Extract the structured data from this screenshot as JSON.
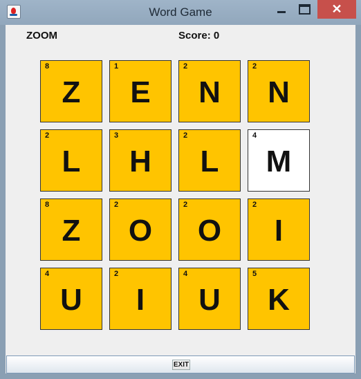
{
  "window": {
    "title": "Word Game",
    "close_symbol": "✕"
  },
  "game": {
    "current_word": "ZOOM",
    "score_label": "Score: 0"
  },
  "tiles": [
    {
      "letter": "Z",
      "points": "8",
      "selected": false
    },
    {
      "letter": "E",
      "points": "1",
      "selected": false
    },
    {
      "letter": "N",
      "points": "2",
      "selected": false
    },
    {
      "letter": "N",
      "points": "2",
      "selected": false
    },
    {
      "letter": "L",
      "points": "2",
      "selected": false
    },
    {
      "letter": "H",
      "points": "3",
      "selected": false
    },
    {
      "letter": "L",
      "points": "2",
      "selected": false
    },
    {
      "letter": "M",
      "points": "4",
      "selected": true
    },
    {
      "letter": "Z",
      "points": "8",
      "selected": false
    },
    {
      "letter": "O",
      "points": "2",
      "selected": false
    },
    {
      "letter": "O",
      "points": "2",
      "selected": false
    },
    {
      "letter": "I",
      "points": "2",
      "selected": false
    },
    {
      "letter": "U",
      "points": "4",
      "selected": false
    },
    {
      "letter": "I",
      "points": "2",
      "selected": false
    },
    {
      "letter": "U",
      "points": "4",
      "selected": false
    },
    {
      "letter": "K",
      "points": "5",
      "selected": false
    }
  ],
  "footer": {
    "exit_label": "EXIT"
  },
  "colors": {
    "tile": "#ffc400",
    "tile_selected": "#ffffff"
  }
}
